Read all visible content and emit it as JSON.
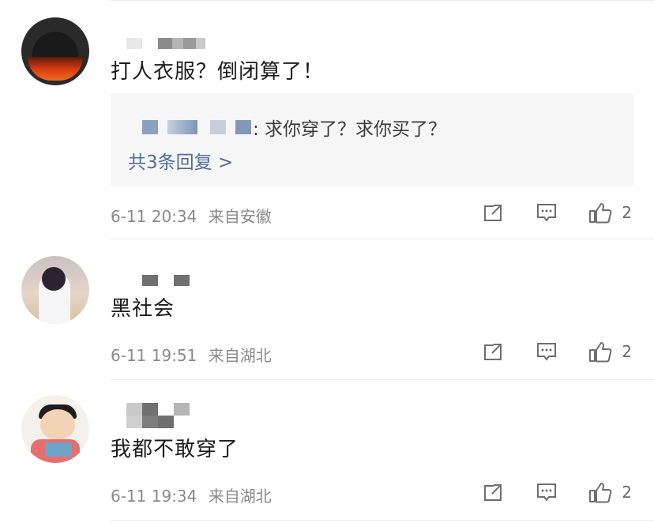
{
  "comments": [
    {
      "text": "打人衣服？倒闭算了！",
      "reply": {
        "text": ": 求你穿了？求你买了？",
        "more": "共3条回复 >"
      },
      "time": "6-11 20:34",
      "location": "来自安徽",
      "likes": "2"
    },
    {
      "text": "黑社会",
      "time": "6-11 19:51",
      "location": "来自湖北",
      "likes": "2"
    },
    {
      "text": "我都不敢穿了",
      "time": "6-11 19:34",
      "location": "来自湖北",
      "likes": "2"
    }
  ],
  "icons": {
    "share": "share-icon",
    "comment": "comment-icon",
    "like": "like-icon"
  },
  "colors": {
    "link": "#4e6e99",
    "meta": "#8a8a8a",
    "reply_bg": "#f6f6f6"
  }
}
